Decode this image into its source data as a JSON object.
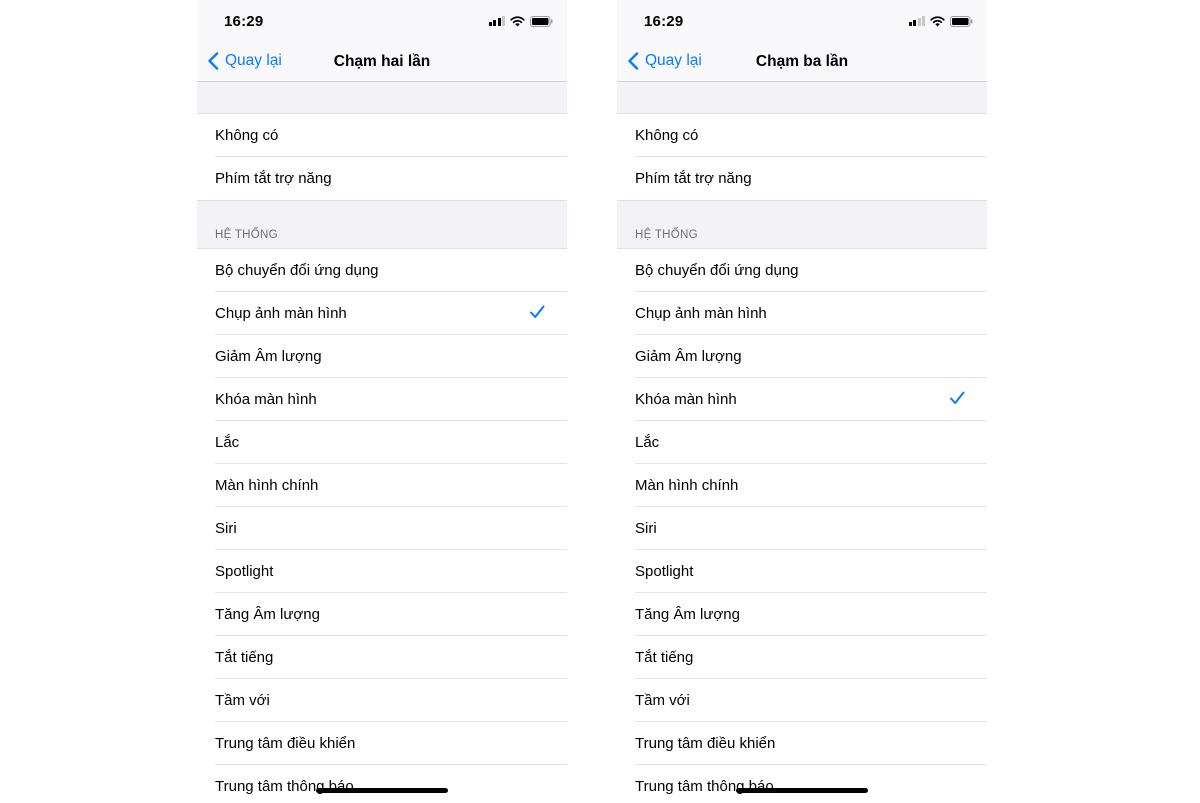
{
  "screens": [
    {
      "status_time": "16:29",
      "signal_bars_on": 3,
      "back_label": "Quay lại",
      "title": "Chạm hai lần",
      "top_items": [
        "Không có",
        "Phím tắt trợ năng"
      ],
      "section_header": "HỆ THỐNG",
      "system_items": [
        "Bộ chuyển đổi ứng dụng",
        "Chụp ảnh màn hình",
        "Giảm Âm lượng",
        "Khóa màn hình",
        "Lắc",
        "Màn hình chính",
        "Siri",
        "Spotlight",
        "Tăng Âm lượng",
        "Tắt tiếng",
        "Tầm với",
        "Trung tâm điều khiển",
        "Trung tâm thông báo"
      ],
      "selected_item": "Chụp ảnh màn hình"
    },
    {
      "status_time": "16:29",
      "signal_bars_on": 2,
      "back_label": "Quay lại",
      "title": "Chạm ba lần",
      "top_items": [
        "Không có",
        "Phím tắt trợ năng"
      ],
      "section_header": "HỆ THỐNG",
      "system_items": [
        "Bộ chuyển đổi ứng dụng",
        "Chụp ảnh màn hình",
        "Giảm Âm lượng",
        "Khóa màn hình",
        "Lắc",
        "Màn hình chính",
        "Siri",
        "Spotlight",
        "Tăng Âm lượng",
        "Tắt tiếng",
        "Tầm với",
        "Trung tâm điều khiển",
        "Trung tâm thông báo"
      ],
      "selected_item": "Khóa màn hình"
    }
  ],
  "colors": {
    "accent": "#0a7aff",
    "grouped_background": "#f2f2f7",
    "section_header": "#6d6d72"
  }
}
